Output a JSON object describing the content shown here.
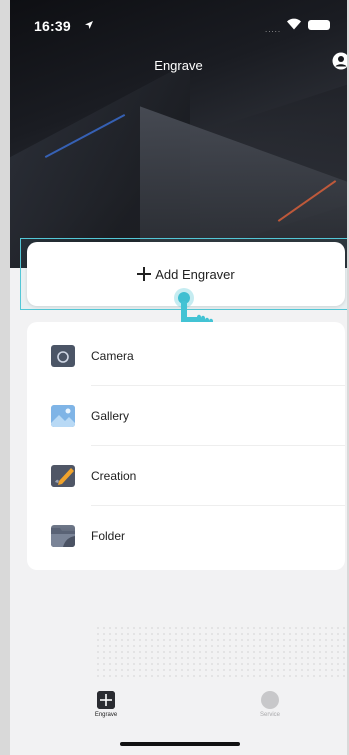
{
  "status_bar": {
    "time": "16:39",
    "signal": "....."
  },
  "header": {
    "title": "Engrave"
  },
  "add_engraver": {
    "label": "Add Engraver"
  },
  "menu": {
    "items": [
      {
        "label": "Camera",
        "icon": "camera-icon"
      },
      {
        "label": "Gallery",
        "icon": "gallery-icon"
      },
      {
        "label": "Creation",
        "icon": "creation-icon"
      },
      {
        "label": "Folder",
        "icon": "folder-icon"
      }
    ]
  },
  "tabbar": {
    "tabs": [
      {
        "label": "Engrave",
        "icon": "engrave-icon",
        "active": true
      },
      {
        "label": "Service",
        "icon": "service-icon",
        "active": false
      }
    ]
  },
  "colors": {
    "accent": "#53c7d6",
    "hero_dark": "#15171b"
  }
}
